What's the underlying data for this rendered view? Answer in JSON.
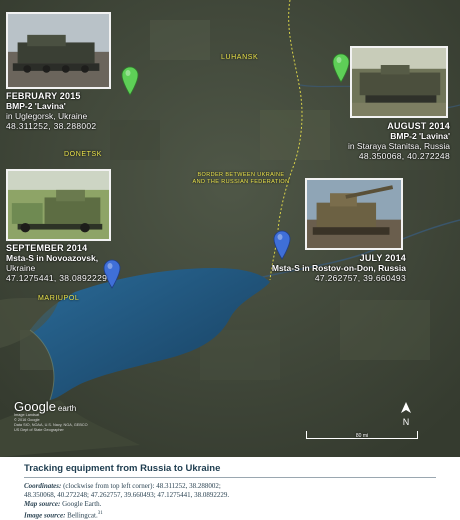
{
  "map": {
    "cities": {
      "luhansk": "LUHANSK",
      "donetsk": "DONETSK",
      "mariupol": "MARIUPOL"
    },
    "border_label": "BORDER BETWEEN UKRAINE\nAND THE RUSSIAN FEDERATION",
    "colors": {
      "border_line": "#e9e14a",
      "pin_green": "#5ecf57",
      "pin_blue": "#3f6fd8",
      "sea": "#1d4f77"
    },
    "icons": {
      "green_pin": "map-pin-icon",
      "blue_pin": "map-pin-icon",
      "north": "north-arrow-icon"
    },
    "google": {
      "logo_google": "Google",
      "logo_earth": "earth",
      "image_data": [
        "Image Landsat",
        "© 2016 Google",
        "Data SIO, NOAA, U.S. Navy, NGA, GEBCO",
        "US Dept of State Geographer"
      ]
    },
    "scale_label": "80 mi",
    "north_label": "N",
    "markers": [
      {
        "date": "FEBRUARY 2015",
        "vehicle": "BMP-2 'Lavina'",
        "location": "in Uglegorsk, Ukraine",
        "coords": "48.311252, 38.288002"
      },
      {
        "date": "AUGUST 2014",
        "vehicle": "BMP-2 'Lavina'",
        "location": "in Staraya Stanitsa, Russia",
        "coords": "48.350068, 40.272248"
      },
      {
        "date": "SEPTEMBER 2014",
        "vehicle": "Msta-S in Novoazovsk,",
        "location": "Ukraine",
        "coords": "47.1275441, 38.0892229"
      },
      {
        "date": "JULY 2014",
        "vehicle": "Msta-S in Rostov-on-Don, Russia",
        "location": "",
        "coords": "47.262757, 39.660493"
      }
    ]
  },
  "caption": {
    "title": "Tracking equipment from Russia to Ukraine",
    "coords_label": "Coordinates:",
    "coords_text": " (clockwise from top left corner): 48.311252, 38.288002;",
    "coords_text2": "48.350068, 40.272248; 47.262757, 39.660493; 47.1275441, 38.0892229.",
    "map_source_label": "Map source:",
    "map_source": " Google Earth.",
    "image_source_label": "Image source:",
    "image_source": " Bellingcat.",
    "footnote": "31"
  }
}
